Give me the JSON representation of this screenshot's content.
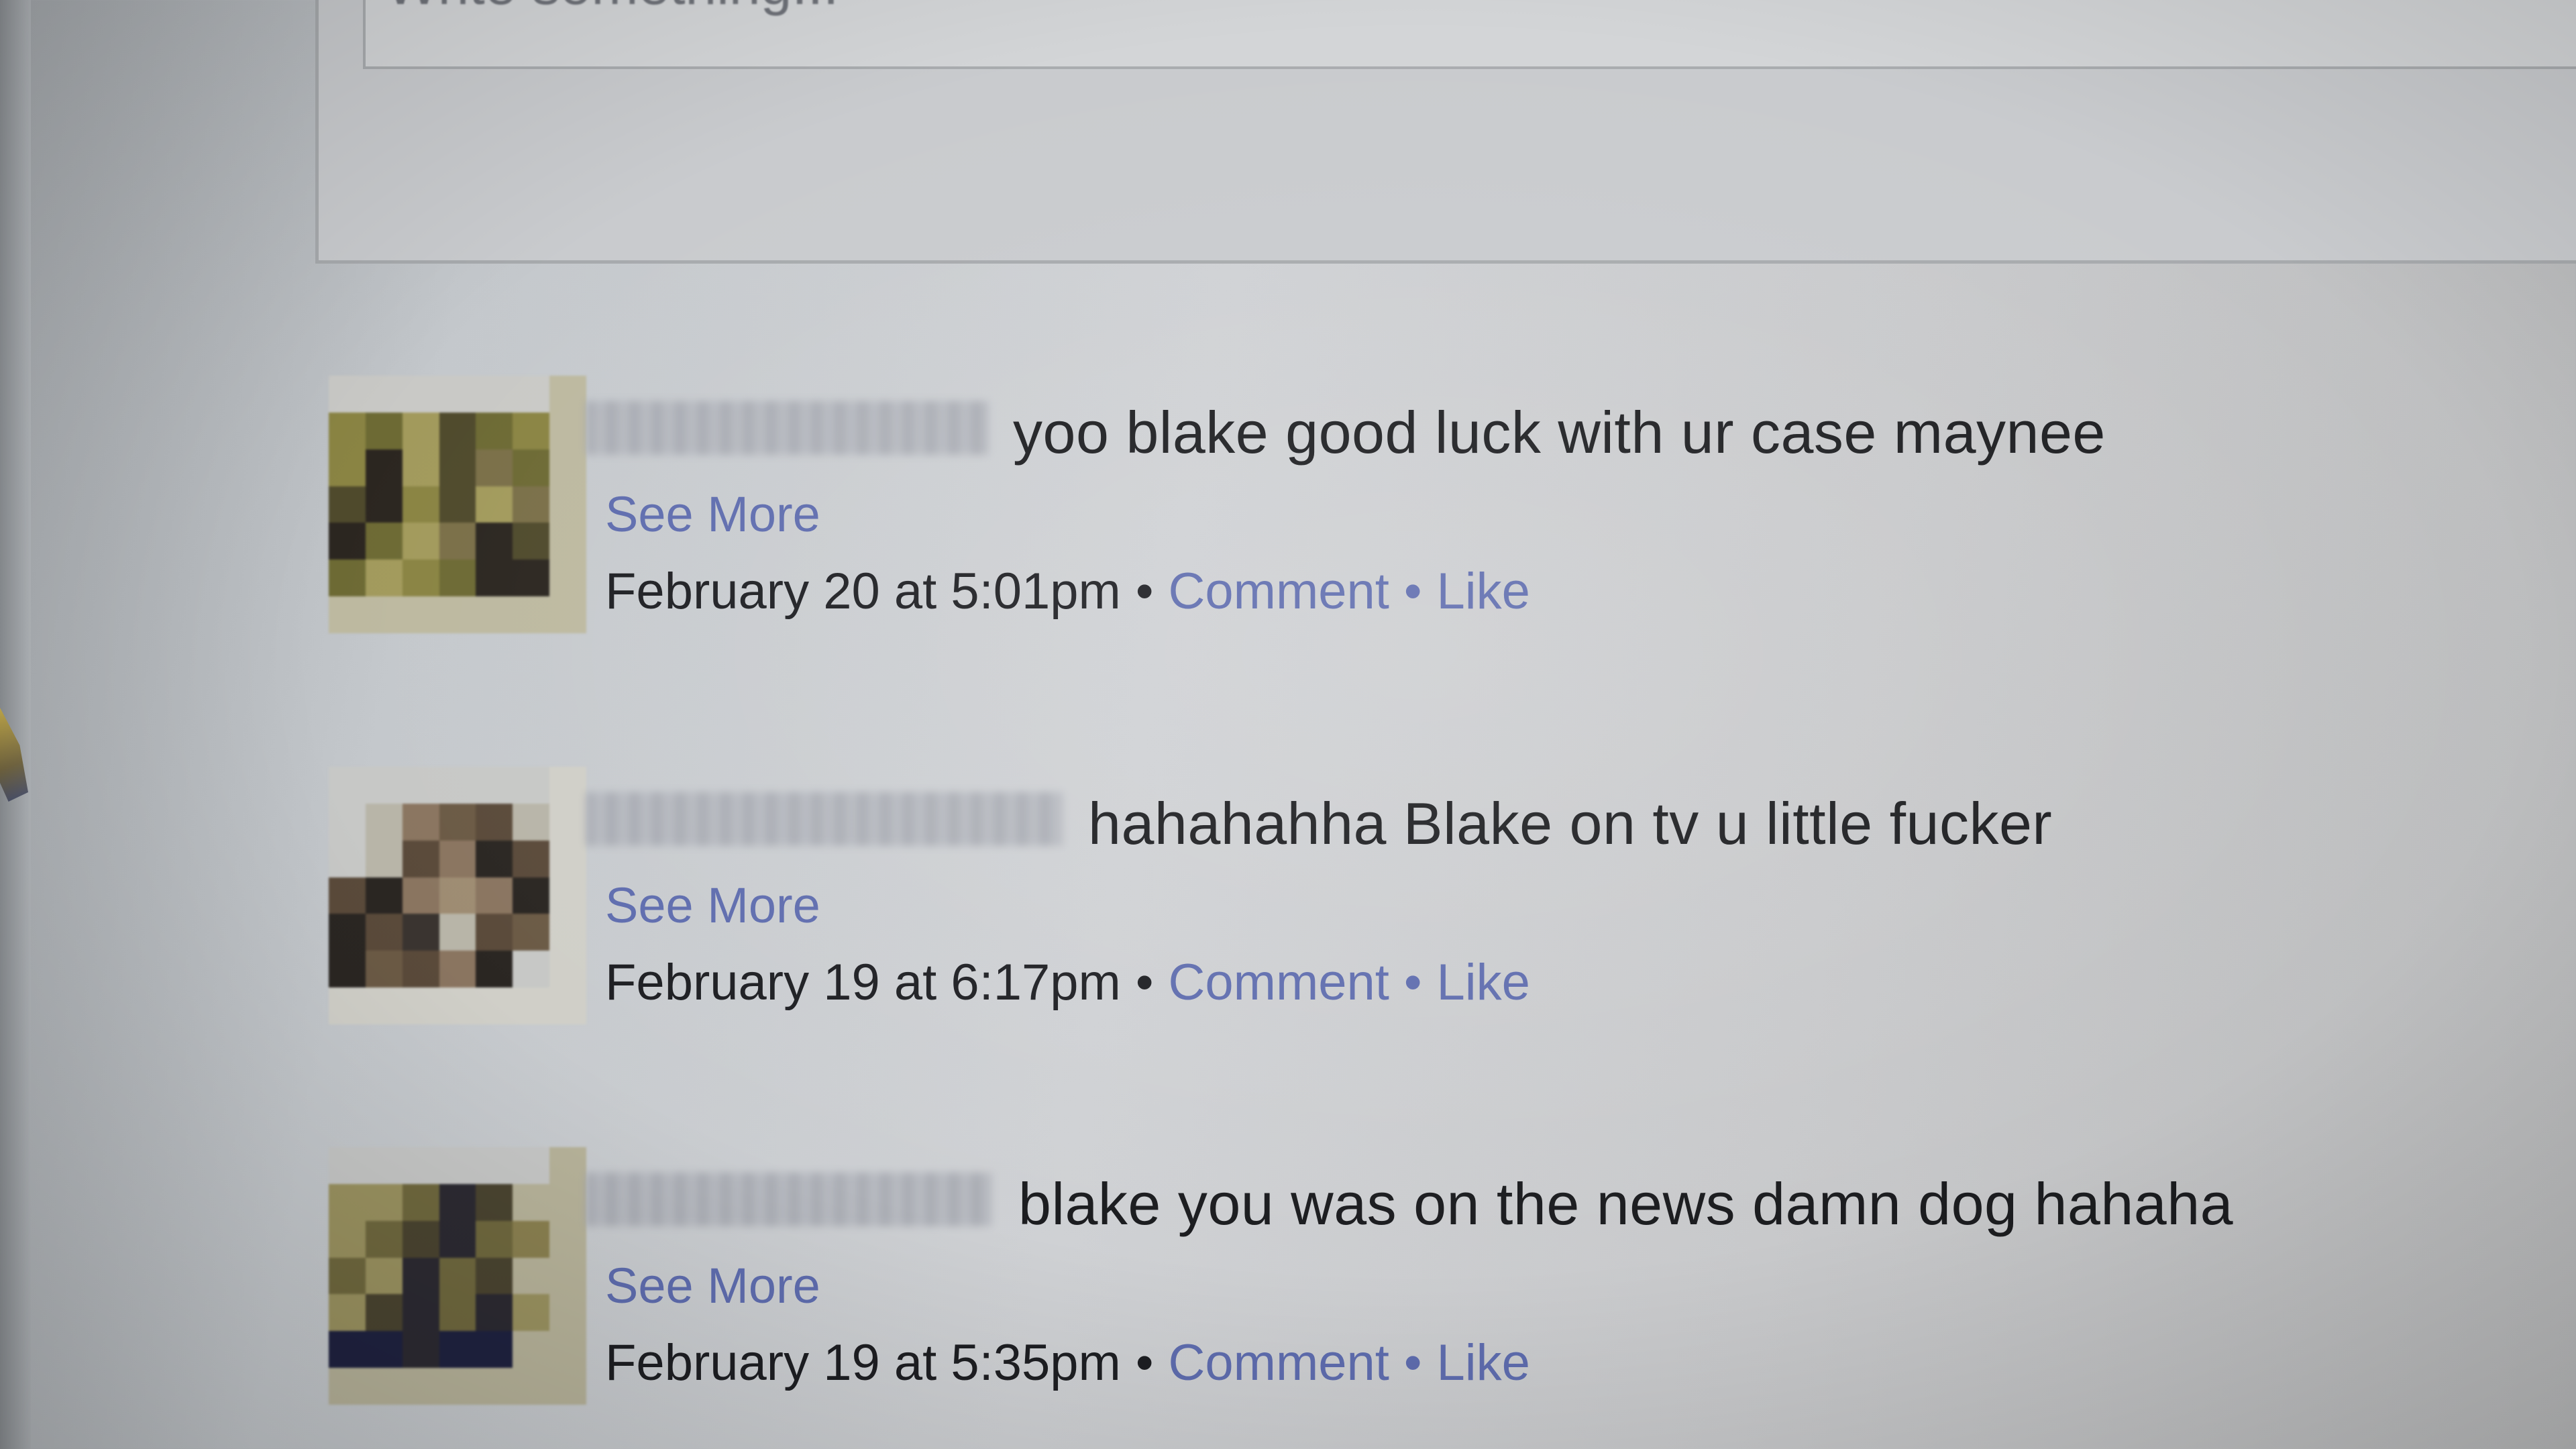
{
  "composer": {
    "placeholder": "Write something..."
  },
  "posts": [
    {
      "text": "yoo blake good luck with ur case maynee",
      "see_more": "See More",
      "timestamp": "February 20 at 5:01pm",
      "separator": "•",
      "comment_label": "Comment",
      "like_label": "Like"
    },
    {
      "text": "hahahahha Blake on tv u little fucker",
      "see_more": "See More",
      "timestamp": "February 19 at 6:17pm",
      "separator": "•",
      "comment_label": "Comment",
      "like_label": "Like"
    },
    {
      "text": "blake you was on the news damn dog hahaha",
      "see_more": "See More",
      "timestamp": "February 19 at 5:35pm",
      "separator": "•",
      "comment_label": "Comment",
      "like_label": "Like"
    }
  ],
  "colors": {
    "link": "#5e6cae",
    "text": "#1b1c1f",
    "background": "#cfd1d4"
  }
}
